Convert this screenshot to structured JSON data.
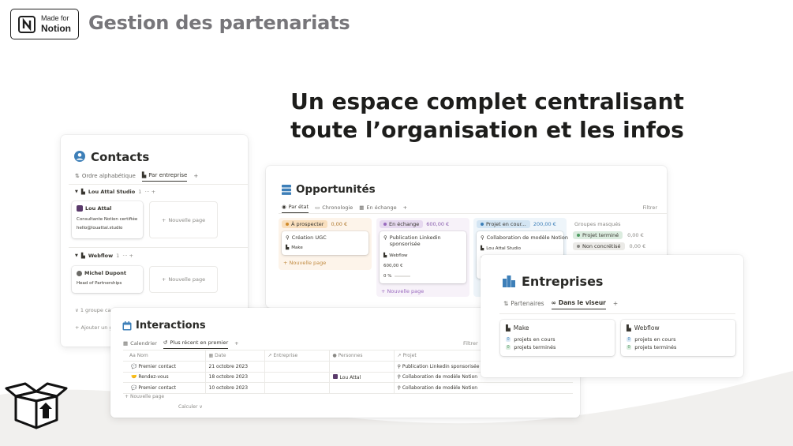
{
  "header": {
    "badge_top": "Made for",
    "badge_bottom": "Notion",
    "title": "Gestion des partenariats"
  },
  "headline": {
    "line1": "Un espace complet centralisant",
    "line2": "toute l’organisation et les infos"
  },
  "contacts": {
    "title": "Contacts",
    "tabs": [
      "Ordre alphabétique",
      "Par entreprise"
    ],
    "groups": [
      {
        "name": "Lou Attal Studio",
        "count": "1",
        "card": {
          "name": "Lou Attal",
          "line1": "Consultante Notion certifiée",
          "line2": "hello@louattal.studio"
        }
      },
      {
        "name": "Webflow",
        "count": "1",
        "card": {
          "name": "Michel Dupont",
          "line1": "Head of Partnerships",
          "line2": ""
        }
      }
    ],
    "new_page": "Nouvelle page",
    "hidden_group": "1 groupe ca",
    "add_group": "Ajouter un g"
  },
  "opportunites": {
    "title": "Opportunités",
    "tabs": [
      "Par état",
      "Chronologie",
      "En échange"
    ],
    "filter": "Filtrer",
    "columns": [
      {
        "status": "À prospecter",
        "amount": "0,00 €",
        "card_title": "Création UGC",
        "card_tag": "Make",
        "new_page": "Nouvelle page"
      },
      {
        "status": "En échange",
        "amount": "600,00 €",
        "card_title": "Publication Linkedin sponsorisée",
        "card_tag": "Webflow",
        "card_amount": "600,00 €",
        "card_percent": "0 %",
        "new_page": "Nouvelle page"
      },
      {
        "status": "Projet en cour...",
        "amount": "200,00 €",
        "card_title": "Collaboration de modèle Notion",
        "card_tag": "Lou Attal Studio",
        "card_amount": "20"
      }
    ],
    "hidden_title": "Groupes masqués",
    "hidden_groups": [
      {
        "label": "Projet terminé",
        "amount": "0,00 €"
      },
      {
        "label": "Non concrétisé",
        "amount": "0,00 €"
      }
    ]
  },
  "interactions": {
    "title": "Interactions",
    "tabs": [
      "Calendrier",
      "Plus récent en premier"
    ],
    "filter": "Filtrer",
    "headers": [
      "Nom",
      "Date",
      "Entreprise",
      "Personnes",
      "Projet"
    ],
    "rows": [
      {
        "nom": "Premier contact",
        "date": "21 octobre 2023",
        "entreprise": "",
        "personne": "",
        "projet": "Publication Linkedin sponsorisée"
      },
      {
        "nom": "Rendez-vous",
        "date": "18 octobre 2023",
        "entreprise": "",
        "personne": "Lou Attal",
        "projet": "Collaboration de modèle Notion"
      },
      {
        "nom": "Premier contact",
        "date": "10 octobre 2023",
        "entreprise": "",
        "personne": "",
        "projet": "Collaboration de modèle Notion"
      }
    ],
    "new_page": "Nouvelle page",
    "calculate": "Calculer"
  },
  "entreprises": {
    "title": "Entreprises",
    "tabs": [
      "Partenaires",
      "Dans le viseur"
    ],
    "cards": [
      {
        "name": "Make",
        "l1n": "0",
        "l1": "projets en cours",
        "l2n": "0",
        "l2": "projets terminés"
      },
      {
        "name": "Webflow",
        "l1n": "0",
        "l1": "projets en cours",
        "l2n": "0",
        "l2": "projets terminés"
      }
    ]
  },
  "colors": {
    "title_gray": "#77767a",
    "accent_blue": "#3d7fb8",
    "orange_bg": "#fbe9d3",
    "purple_bg": "#ece3f3",
    "blue_bg": "#dceaf5",
    "green_bg": "#dbecdf"
  }
}
